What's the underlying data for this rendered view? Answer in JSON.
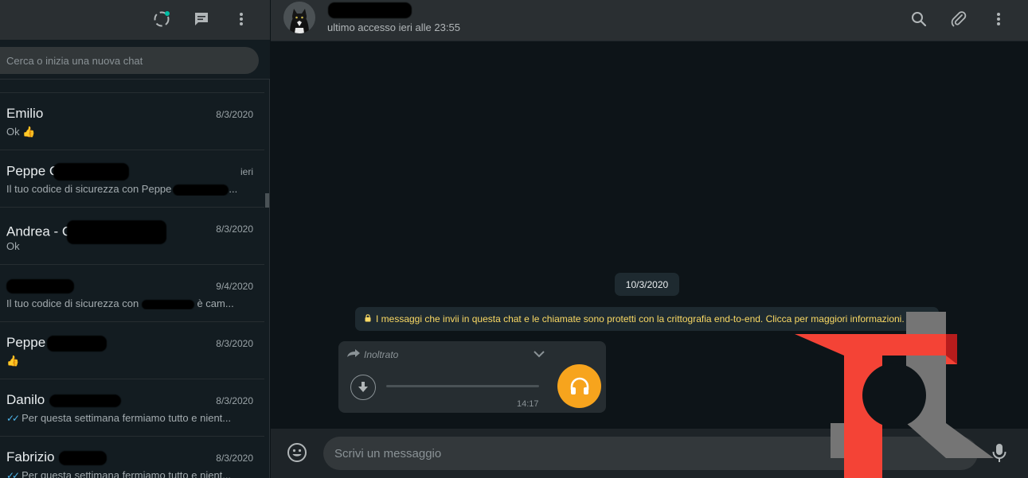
{
  "sidebar": {
    "search_placeholder": "Cerca o inizia una nuova chat",
    "chats": [
      {
        "name": "Emilio",
        "date": "8/3/2020",
        "preview": "Ok 👍"
      },
      {
        "name": "Peppe G",
        "date": "ieri",
        "preview": "Il tuo codice di sicurezza con Peppe"
      },
      {
        "name": "Andrea - C",
        "date": "8/3/2020",
        "preview": "Ok"
      },
      {
        "name": "",
        "date": "9/4/2020",
        "preview_start": "Il tuo codice di sicurezza con",
        "preview_end": "è cam..."
      },
      {
        "name": "Peppe",
        "date": "8/3/2020",
        "preview": "👍"
      },
      {
        "name": "Danilo",
        "date": "8/3/2020",
        "preview": "Per questa settimana fermiamo tutto e nient..."
      },
      {
        "name": "Fabrizio",
        "date": "8/3/2020",
        "preview": "Per questa settimana fermiamo tutto e nient..."
      }
    ]
  },
  "conversation": {
    "last_seen": "ultimo accesso ieri alle 23:55",
    "date_divider": "10/3/2020",
    "encryption_notice": "I messaggi che invii in questa chat e le chiamate sono protetti con la crittografia end-to-end. Clicca per maggiori informazioni.",
    "voice_message": {
      "forwarded_label": "Inoltrato",
      "duration": "14:17",
      "progress": 0
    },
    "compose_placeholder": "Scrivi un messaggio"
  },
  "colors": {
    "accent_orange": "#f7a41d",
    "read_ticks": "#4fb6ec",
    "encryption_text": "#fad964",
    "status_dot": "#00bfa5",
    "logo_red": "#f44336",
    "logo_gray": "#757575"
  },
  "icons": {
    "header_left": [
      "status-icon",
      "new-chat-icon",
      "menu-icon"
    ],
    "header_right": [
      "search-icon",
      "attach-icon",
      "menu-icon"
    ],
    "footer": [
      "emoji-icon",
      "microphone-icon"
    ]
  }
}
